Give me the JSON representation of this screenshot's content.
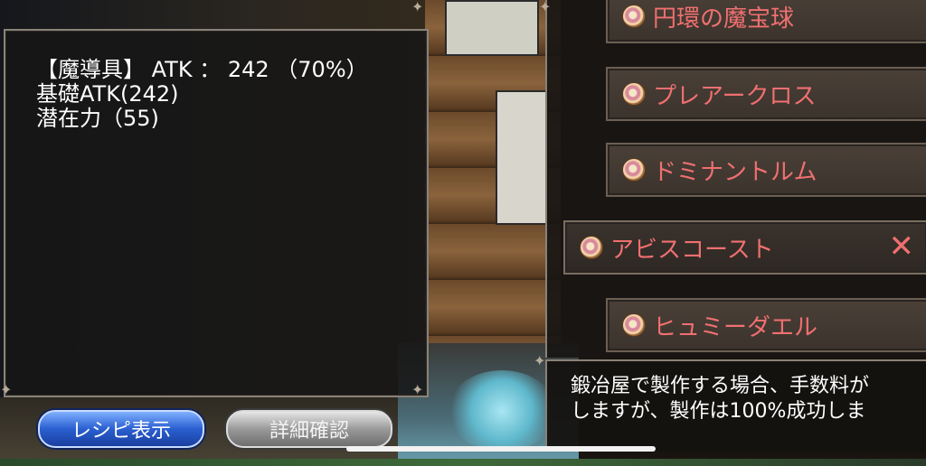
{
  "status": {
    "line1": "【魔導具】 ATK ： 242 （70%）",
    "line2": "基礎ATK(242)",
    "line3": "潜在力（55)"
  },
  "items": [
    {
      "label": "円環の魔宝球",
      "icon": "orb-icon"
    },
    {
      "label": "プレアークロス",
      "icon": "orb-icon"
    },
    {
      "label": "ドミナントルム",
      "icon": "orb-icon"
    },
    {
      "label": "アビスコースト",
      "icon": "orb-icon",
      "selected": true
    },
    {
      "label": "ヒュミーダエル",
      "icon": "orb-icon"
    }
  ],
  "remove_symbol": "✕",
  "description": {
    "line1": "鍛冶屋で製作する場合、手数料が",
    "line2": "しますが、製作は100%成功しま"
  },
  "buttons": {
    "recipe": "レシピ表示",
    "detail": "詳細確認"
  },
  "colors": {
    "item_text": "#f07070",
    "recipe_button": "#2a5fd0",
    "detail_button": "#9a9a9a"
  }
}
